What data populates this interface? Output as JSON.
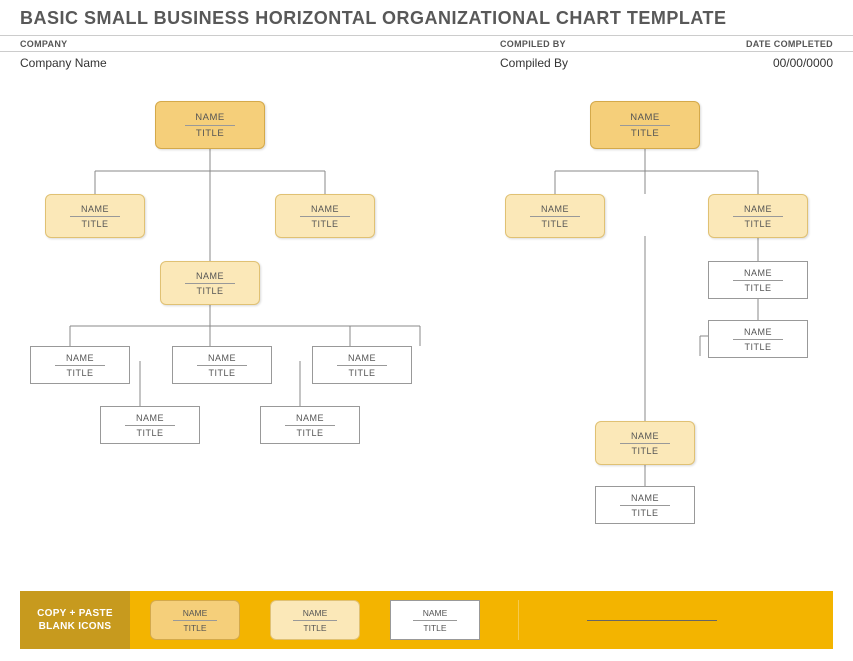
{
  "page_title": "BASIC SMALL BUSINESS HORIZONTAL ORGANIZATIONAL CHART TEMPLATE",
  "header": {
    "company_label": "COMPANY",
    "compiled_label": "COMPILED BY",
    "date_label": "DATE COMPLETED",
    "company_value": "Company Name",
    "compiled_value": "Compiled By",
    "date_value": "00/00/0000"
  },
  "node_text": {
    "name": "NAME",
    "title": "TITLE"
  },
  "footer": {
    "label_line1": "COPY + PASTE",
    "label_line2": "BLANK ICONS"
  },
  "colors": {
    "gold_dark": "#f5cf7a",
    "gold_light": "#fbe8b8",
    "footer_main": "#f3b400",
    "footer_side": "#c79a1e"
  }
}
